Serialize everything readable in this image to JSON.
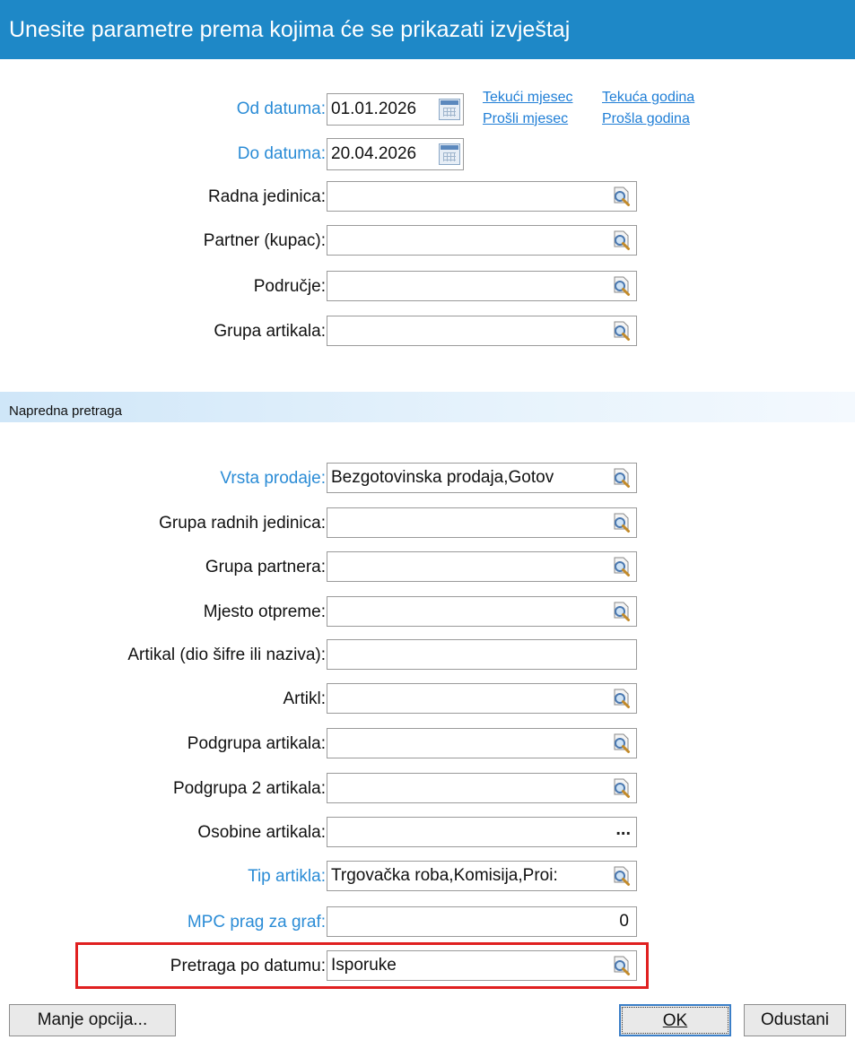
{
  "window": {
    "title": "Unesite parametre prema kojima će se prikazati izvještaj"
  },
  "dates": {
    "from_label": "Od datuma:",
    "from_value": "01.01.2026",
    "to_label": "Do datuma:",
    "to_value": "20.04.2026"
  },
  "quick_links": {
    "current_month": "Tekući mjesec",
    "current_year": "Tekuća godina",
    "previous_month": "Prošli mjesec",
    "previous_year": "Prošla godina"
  },
  "basic_fields": [
    {
      "label": "Radna jedinica:",
      "value": ""
    },
    {
      "label": "Partner (kupac):",
      "value": ""
    },
    {
      "label": "Područje:",
      "value": ""
    },
    {
      "label": "Grupa artikala:",
      "value": ""
    }
  ],
  "advanced": {
    "section_title": "Napredna pretraga",
    "fields": [
      {
        "label": "Vrsta prodaje:",
        "value": "Bezgotovinska prodaja,Gotov",
        "icon": "lookup-icon"
      },
      {
        "label": "Grupa radnih jedinica:",
        "value": "",
        "icon": "lookup-icon"
      },
      {
        "label": "Grupa partnera:",
        "value": "",
        "icon": "lookup-icon"
      },
      {
        "label": "Mjesto otpreme:",
        "value": "",
        "icon": "lookup-icon"
      },
      {
        "label": "Artikal (dio šifre ili naziva):",
        "value": "",
        "icon": ""
      },
      {
        "label": "Artikl:",
        "value": "",
        "icon": "lookup-icon"
      },
      {
        "label": "Podgrupa artikala:",
        "value": "",
        "icon": "lookup-icon"
      },
      {
        "label": "Podgrupa 2 artikala:",
        "value": "",
        "icon": "lookup-icon"
      },
      {
        "label": "Osobine artikala:",
        "value": "",
        "icon": "ellipsis",
        "button_text": "..."
      },
      {
        "label": "Tip artikla:",
        "value": "Trgovačka roba,Komisija,Proi:",
        "icon": "lookup-icon"
      },
      {
        "label": "MPC prag za graf:",
        "value": "0",
        "icon": ""
      },
      {
        "label": "Pretraga po datumu:",
        "value": "Isporuke",
        "icon": "lookup-icon"
      }
    ]
  },
  "buttons": {
    "fewer_options": "Manje opcija...",
    "ok": "OK",
    "cancel": "Odustani"
  },
  "colors": {
    "title_bar": "#1e88c7",
    "link_blue": "#2b8cd6",
    "highlight_red": "#e02020",
    "section_band": "#cfe6f8"
  }
}
